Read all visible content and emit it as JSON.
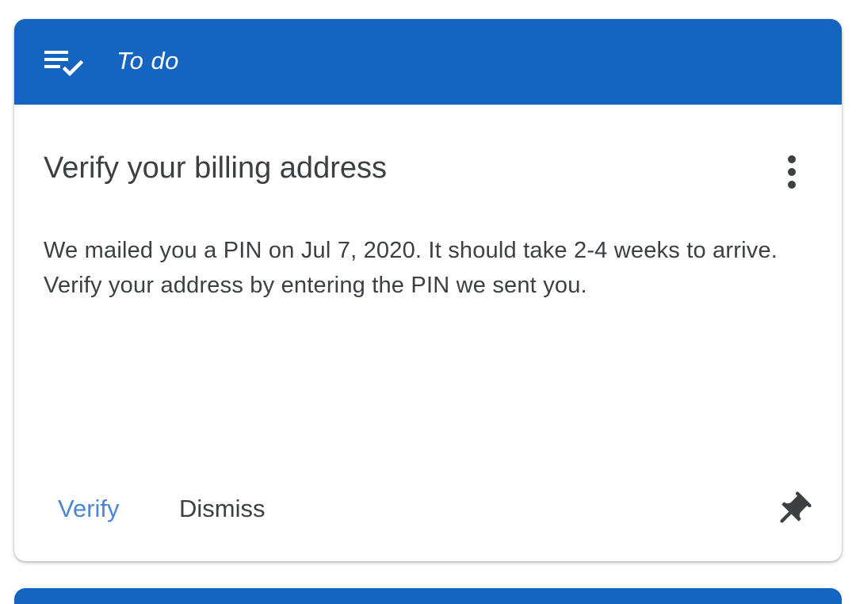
{
  "card": {
    "header": {
      "icon": "playlist-check-icon",
      "title": "To do"
    },
    "title": "Verify your billing address",
    "menu_icon": "more-vert-icon",
    "body": "We mailed you a PIN on Jul 7, 2020. It should take 2-4 weeks to arrive. Verify your address by entering the PIN we sent you.",
    "actions": {
      "verify_label": "Verify",
      "dismiss_label": "Dismiss",
      "pin_icon": "pin-icon"
    }
  },
  "colors": {
    "header_background": "#1565c0",
    "primary_action": "#4a86d4",
    "text": "#3c4043",
    "header_text": "#ffffff"
  }
}
